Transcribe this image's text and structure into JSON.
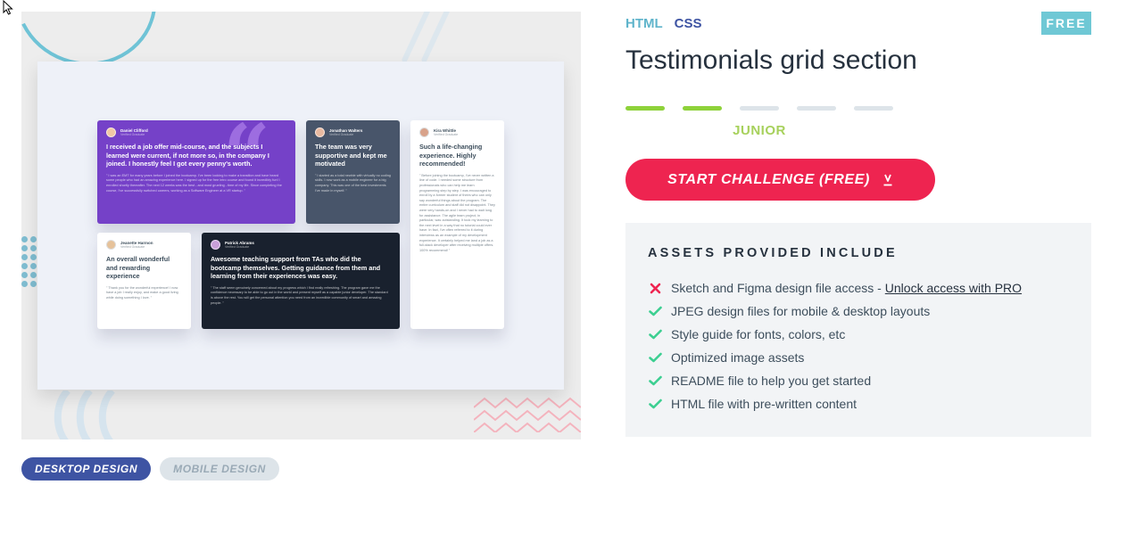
{
  "challenge": {
    "languages": [
      "HTML",
      "CSS"
    ],
    "price_badge": "FREE",
    "title": "Testimonials grid section",
    "difficulty": {
      "label": "JUNIOR",
      "level": 2,
      "max_level": 5
    },
    "start_button": "START CHALLENGE (FREE)"
  },
  "preview_tabs": {
    "desktop": "DESKTOP DESIGN",
    "mobile": "MOBILE DESIGN",
    "active": "desktop"
  },
  "preview": {
    "cards": [
      {
        "name": "Daniel Clifford",
        "role": "Verified Graduate",
        "heading": "I received a job offer mid-course, and the subjects I learned were current, if not more so, in the company I joined. I honestly feel I got every penny's worth.",
        "text": "\" I was an EMT for many years before I joined the bootcamp. I've been looking to make a transition and have heard some people who had an amazing experience here. I signed up for the free intro course and found it incredibly fun! I enrolled shortly thereafter. The next 12 weeks was the best - and most grueling - time of my life. Since completing the course, I've successfully switched careers, working as a Software Engineer at a VR startup. \""
      },
      {
        "name": "Jonathan Walters",
        "role": "Verified Graduate",
        "heading": "The team was very supportive and kept me motivated",
        "text": "\" I started as a total newbie with virtually no coding skills. I now work as a mobile engineer for a big company. This was one of the best investments I've made in myself. \""
      },
      {
        "name": "Kira Whittle",
        "role": "Verified Graduate",
        "heading": "Such a life-changing experience. Highly recommended!",
        "text": "\" Before joining the bootcamp, I've never written a line of code. I needed some structure from professionals who can help me learn programming step by step. I was encouraged to enroll by a former student of theirs who can only say wonderful things about the program. The entire curriculum and staff did not disappoint. They were very hands-on and I never had to wait long for assistance. The agile team project, in particular, was outstanding. It took my learning to the next level in a way that no tutorial could ever have. In fact, I've often referred to it during interviews as an example of my development experience. It certainly helped me land a job as a full-stack developer after receiving multiple offers. 100% recommend! \""
      },
      {
        "name": "Jeanette Harmon",
        "role": "Verified Graduate",
        "heading": "An overall wonderful and rewarding experience",
        "text": "\" Thank you for the wonderful experience! I now have a job I really enjoy, and make a good living while doing something I love. \""
      },
      {
        "name": "Patrick Abrams",
        "role": "Verified Graduate",
        "heading": "Awesome teaching support from TAs who did the bootcamp themselves. Getting guidance from them and learning from their experiences was easy.",
        "text": "\" The staff seem genuinely concerned about my progress which I find really refreshing. The program gave me the confidence necessary to be able to go out in the world and present myself as a capable junior developer. The standard is above the rest. You will get the personal attention you need from an incredible community of smart and amazing people. \""
      }
    ]
  },
  "assets": {
    "heading": "ASSETS PROVIDED INCLUDE",
    "items": [
      {
        "included": false,
        "text": "Sketch and Figma design file access - ",
        "link": "Unlock access with PRO"
      },
      {
        "included": true,
        "text": "JPEG design files for mobile & desktop layouts"
      },
      {
        "included": true,
        "text": "Style guide for fonts, colors, etc"
      },
      {
        "included": true,
        "text": "Optimized image assets"
      },
      {
        "included": true,
        "text": "README file to help you get started"
      },
      {
        "included": true,
        "text": "HTML file with pre-written content"
      }
    ]
  },
  "colors": {
    "accent_red": "#ee2450",
    "html_tag": "#5fb4cb",
    "css_tag": "#3e54a3",
    "level_on": "#8ed23a",
    "check": "#3ccf91",
    "cross": "#ee2450"
  },
  "icons": {
    "included": "check-icon",
    "excluded": "cross-icon",
    "start": "download-arrow-icon"
  }
}
